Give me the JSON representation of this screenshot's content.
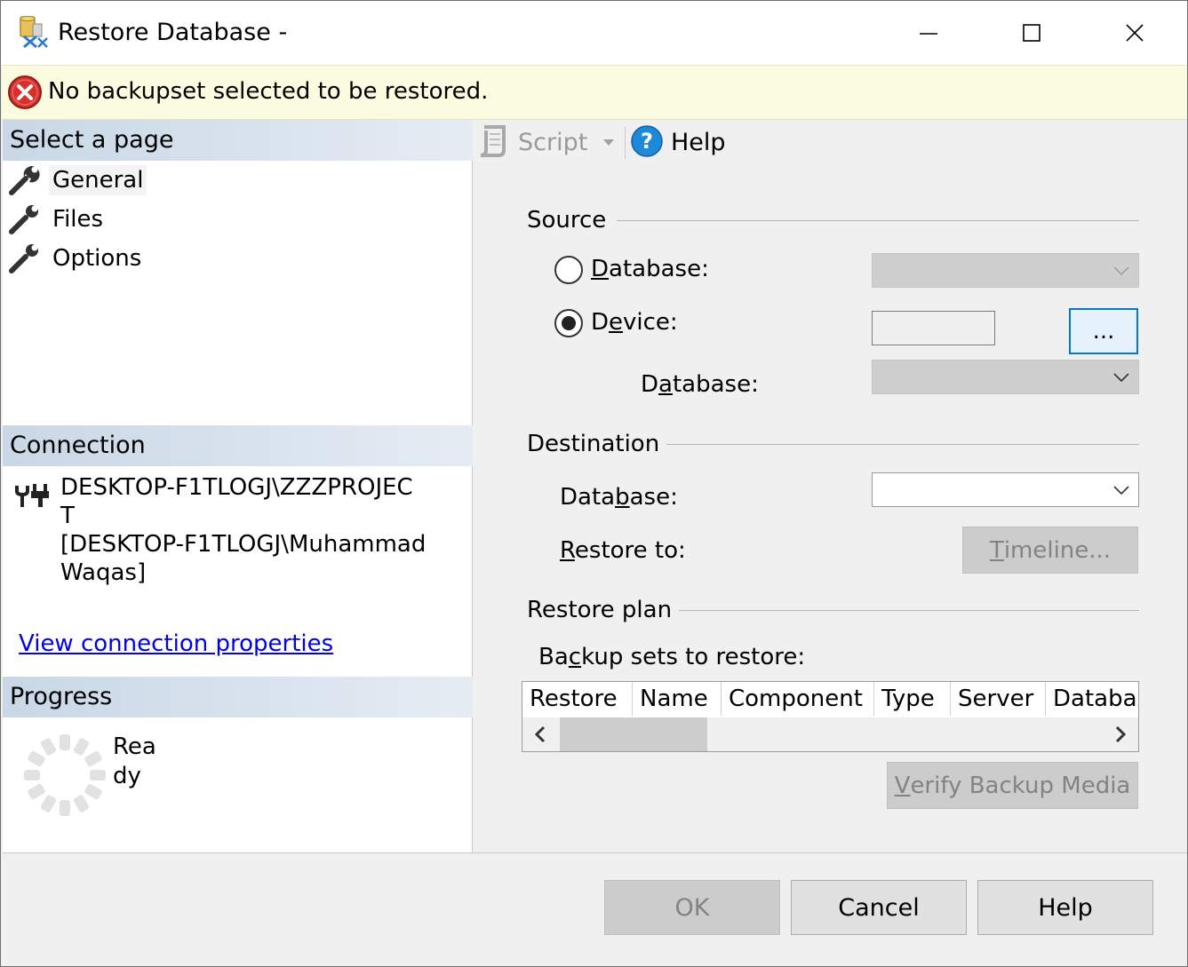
{
  "window": {
    "title": "Restore Database -"
  },
  "banner": {
    "message": "No backupset selected to be restored."
  },
  "left": {
    "select_page_header": "Select a page",
    "pages": [
      {
        "label": "General",
        "selected": true
      },
      {
        "label": "Files",
        "selected": false
      },
      {
        "label": "Options",
        "selected": false
      }
    ],
    "connection_header": "Connection",
    "connection_lines": [
      "DESKTOP-F1TLOGJ\\ZZZPROJEC",
      "T",
      "[DESKTOP-F1TLOGJ\\Muhammad",
      "Waqas]"
    ],
    "connection_link": "View connection properties",
    "progress_header": "Progress",
    "progress_lines": [
      "Rea",
      "dy"
    ]
  },
  "toolbar": {
    "script_label": "Script",
    "help_label": "Help"
  },
  "source": {
    "group_label": "Source",
    "database_radio_pre": "",
    "database_radio_u": "D",
    "database_radio_post": "atabase:",
    "device_radio_pre": "D",
    "device_radio_u": "e",
    "device_radio_post": "vice:",
    "browse_label": "...",
    "device_db_pre": "D",
    "device_db_u": "a",
    "device_db_post": "tabase:",
    "selected_radio": "device"
  },
  "destination": {
    "group_label": "Destination",
    "db_pre": "Data",
    "db_u": "b",
    "db_post": "ase:",
    "restore_to_pre": "",
    "restore_to_u": "R",
    "restore_to_post": "estore to:",
    "timeline_u": "T",
    "timeline_post": "imeline..."
  },
  "restore_plan": {
    "group_label": "Restore plan",
    "backup_sets_pre": "Ba",
    "backup_sets_u": "c",
    "backup_sets_post": "kup sets to restore:",
    "columns": [
      "Restore",
      "Name",
      "Component",
      "Type",
      "Server",
      "Databas"
    ],
    "verify_u": "V",
    "verify_post": "erify Backup Media"
  },
  "footer": {
    "ok_label": "OK",
    "cancel_label": "Cancel",
    "help_label": "Help"
  },
  "colors": {
    "banner_bg": "#fbfbdf",
    "section_header": "#c9d7e6",
    "link": "#0000ee",
    "focus_border": "#0078d7"
  },
  "icons": {
    "app": "restore-database-icon",
    "error": "error-circle-icon",
    "page": "wrench-icon",
    "connection": "plug-icon",
    "progress": "spinner-icon",
    "script": "script-icon",
    "help": "help-question-icon"
  }
}
